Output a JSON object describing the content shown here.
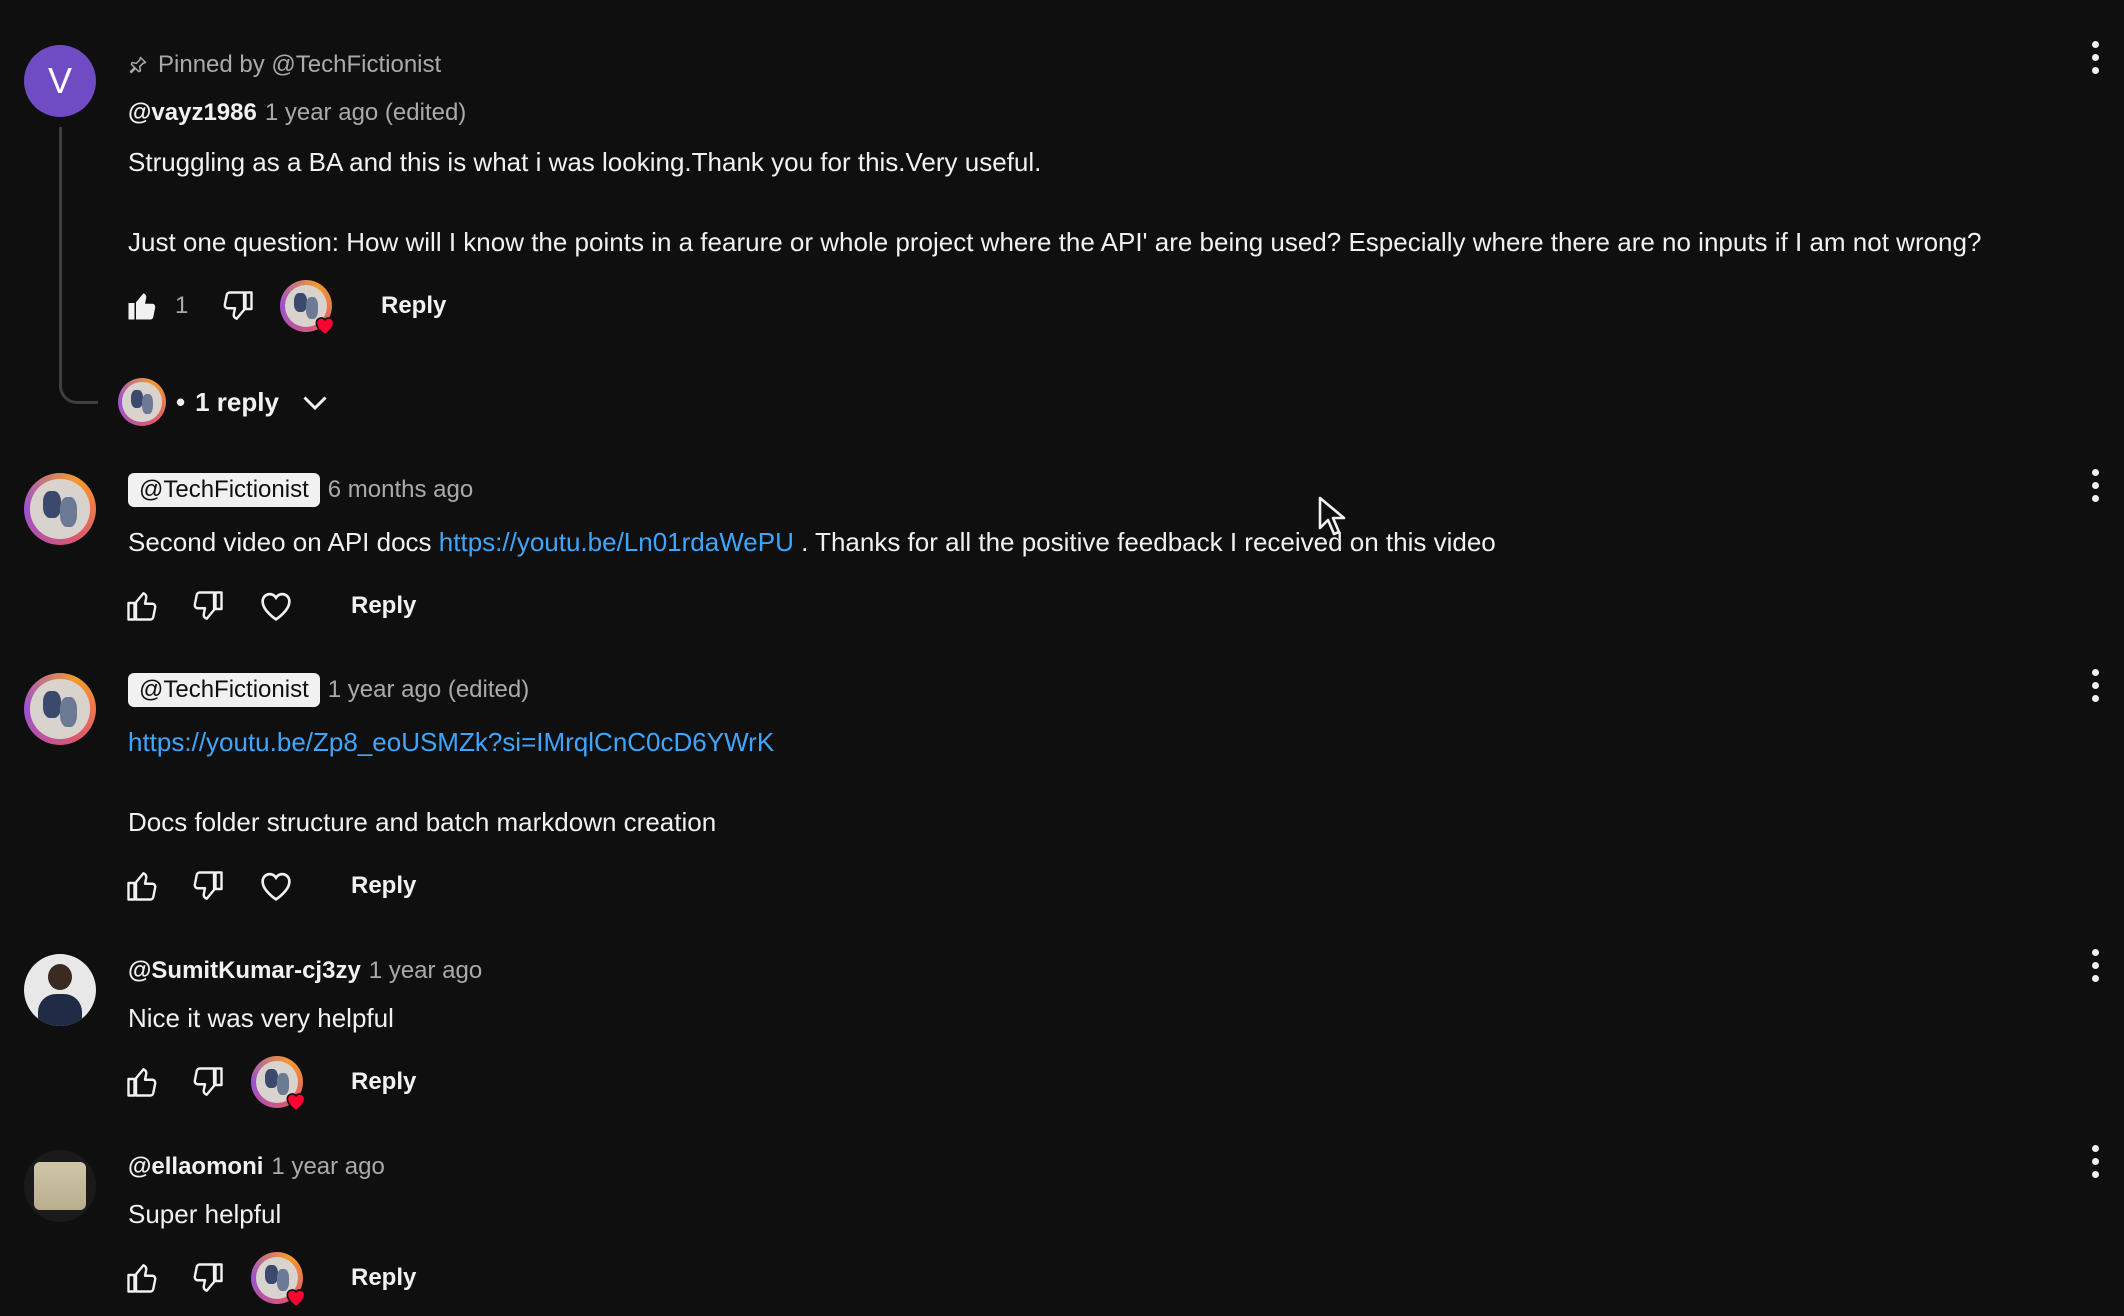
{
  "pinned": {
    "icon": "pin-icon",
    "label": "Pinned by @TechFictionist"
  },
  "comments": [
    {
      "author": "@vayz1986",
      "time": "1 year ago (edited)",
      "avatar_letter": "V",
      "avatar_color": "#6f4cc3",
      "lines": [
        "Struggling as a BA and this is what i was looking.Thank you for this.Very useful.",
        "Just one question: How will I know the points in a fearure or whole project where the API' are being used? Especially where there are no inputs if I am not wrong?"
      ],
      "like_count": "1",
      "liked": true,
      "creator_hearted": true,
      "reply_label": "Reply",
      "replies_toggle": "1 reply"
    },
    {
      "author": "@TechFictionist",
      "time": "6 months ago",
      "is_creator": true,
      "text_before": "Second video on API docs ",
      "link": "https://youtu.be/Ln01rdaWePU",
      "text_after": " . Thanks for all the positive feedback I received on this video",
      "reply_label": "Reply"
    },
    {
      "author": "@TechFictionist",
      "time": "1 year ago (edited)",
      "is_creator": true,
      "link": "https://youtu.be/Zp8_eoUSMZk?si=IMrqlCnC0cD6YWrK",
      "text": "Docs folder structure and batch markdown creation",
      "reply_label": "Reply"
    },
    {
      "author": "@SumitKumar-cj3zy",
      "time": "1 year ago",
      "text": "Nice it was very helpful",
      "creator_hearted": true,
      "reply_label": "Reply"
    },
    {
      "author": "@ellaomoni",
      "time": "1 year ago",
      "text": "Super helpful",
      "creator_hearted": true,
      "reply_label": "Reply"
    }
  ],
  "colors": {
    "background": "#0f0f0f",
    "text": "#f1f1f1",
    "muted": "#aaaaaa",
    "link": "#3ea6ff",
    "heart": "#ff0033"
  }
}
